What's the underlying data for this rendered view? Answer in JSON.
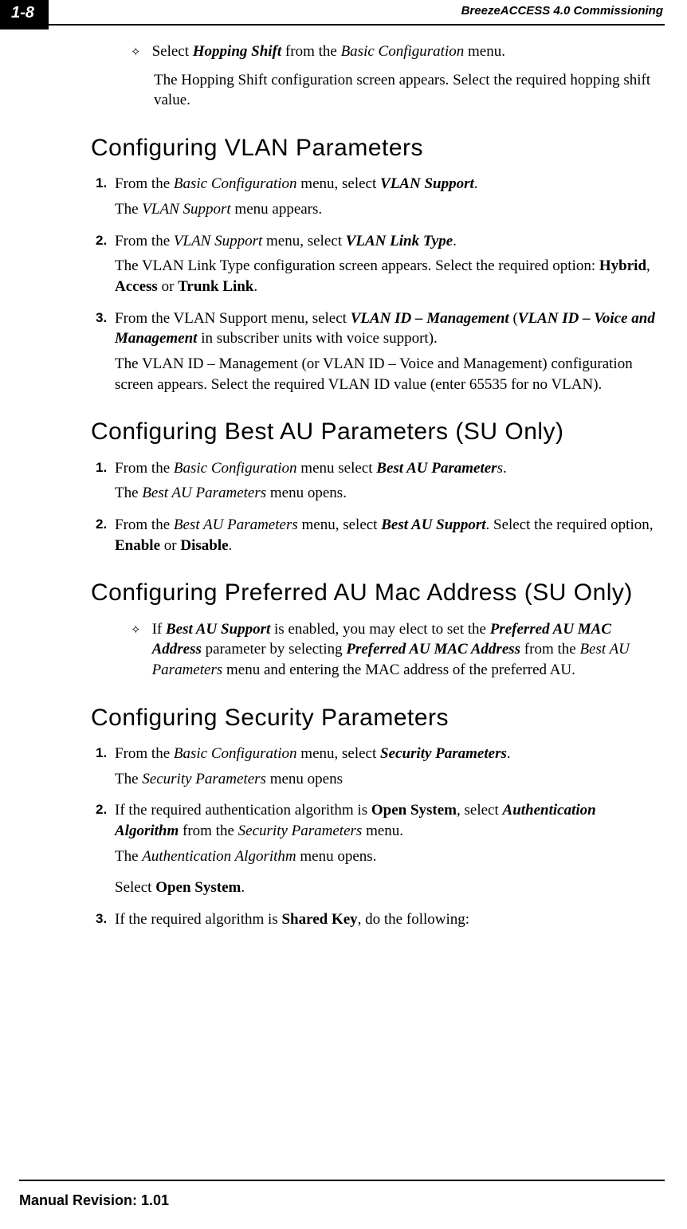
{
  "header": {
    "page_number": "1-8",
    "doc_title": "BreezeACCESS 4.0 Commissioning"
  },
  "intro": {
    "bullet_prefix": "Select ",
    "bullet_bold": "Hopping Shift",
    "bullet_mid": " from the ",
    "bullet_italic": "Basic Configuration",
    "bullet_suffix": " menu.",
    "follow": "The Hopping Shift configuration screen appears. Select the required hopping shift value."
  },
  "sections": {
    "vlan": {
      "title": "Configuring VLAN Parameters",
      "items": [
        {
          "num": "1.",
          "parts": [
            {
              "t": "From the "
            },
            {
              "t": "Basic Configuration",
              "i": true
            },
            {
              "t": " menu, select "
            },
            {
              "t": "VLAN Support",
              "bi": true
            },
            {
              "t": "."
            }
          ],
          "sub": [
            {
              "parts": [
                {
                  "t": "The "
                },
                {
                  "t": "VLAN Support",
                  "i": true
                },
                {
                  "t": " menu appears."
                }
              ]
            }
          ]
        },
        {
          "num": "2.",
          "parts": [
            {
              "t": "From the "
            },
            {
              "t": "VLAN Support",
              "i": true
            },
            {
              "t": " menu, select "
            },
            {
              "t": "VLAN Link Type",
              "bi": true
            },
            {
              "t": "."
            }
          ],
          "sub": [
            {
              "parts": [
                {
                  "t": "The VLAN Link Type configuration screen appears. Select the required option: "
                },
                {
                  "t": "Hybrid",
                  "b": true
                },
                {
                  "t": ", "
                },
                {
                  "t": "Access",
                  "b": true
                },
                {
                  "t": " or "
                },
                {
                  "t": "Trunk Link",
                  "b": true
                },
                {
                  "t": "."
                }
              ]
            }
          ]
        },
        {
          "num": "3.",
          "parts": [
            {
              "t": "From the VLAN Support menu, select "
            },
            {
              "t": "VLAN ID – Management",
              "bi": true
            },
            {
              "t": " ("
            },
            {
              "t": "VLAN ID – Voice and Management",
              "bi": true
            },
            {
              "t": " in subscriber units with voice support)."
            }
          ],
          "sub": [
            {
              "parts": [
                {
                  "t": "The VLAN ID – Management (or VLAN ID – Voice and Management) configuration screen appears. Select the required VLAN ID value (enter 65535 for no VLAN)."
                }
              ]
            }
          ]
        }
      ]
    },
    "bestau": {
      "title": "Configuring Best AU Parameters (SU Only)",
      "items": [
        {
          "num": "1.",
          "parts": [
            {
              "t": "From the "
            },
            {
              "t": "Basic Configuration",
              "i": true
            },
            {
              "t": " menu select "
            },
            {
              "t": "Best AU Parameter",
              "bi": true
            },
            {
              "t": "s",
              "i": true
            },
            {
              "t": "."
            }
          ],
          "sub": [
            {
              "parts": [
                {
                  "t": "The "
                },
                {
                  "t": "Best AU Parameters",
                  "i": true
                },
                {
                  "t": " menu opens."
                }
              ]
            }
          ]
        },
        {
          "num": "2.",
          "parts": [
            {
              "t": "From the "
            },
            {
              "t": "Best AU Parameters",
              "i": true
            },
            {
              "t": " menu, select "
            },
            {
              "t": "Best AU Support",
              "bi": true
            },
            {
              "t": ". Select the required option, "
            },
            {
              "t": "Enable",
              "b": true
            },
            {
              "t": " or "
            },
            {
              "t": "Disable",
              "b": true
            },
            {
              "t": "."
            }
          ],
          "sub": []
        }
      ]
    },
    "mac": {
      "title": "Configuring Preferred AU Mac Address (SU Only)",
      "bullet_parts": [
        {
          "t": "If "
        },
        {
          "t": "Best AU Support",
          "bi": true
        },
        {
          "t": " is enabled, you may elect to set the "
        },
        {
          "t": "Preferred AU MAC Address",
          "bi": true
        },
        {
          "t": " parameter by selecting "
        },
        {
          "t": "Preferred AU MAC Address",
          "bi": true
        },
        {
          "t": " from the "
        },
        {
          "t": "Best AU Parameters",
          "i": true
        },
        {
          "t": " menu and entering the MAC address of the preferred AU."
        }
      ]
    },
    "security": {
      "title": "Configuring Security Parameters",
      "items": [
        {
          "num": "1.",
          "parts": [
            {
              "t": "From the "
            },
            {
              "t": "Basic Configuration",
              "i": true
            },
            {
              "t": " menu, select "
            },
            {
              "t": "Security Parameters",
              "bi": true
            },
            {
              "t": "."
            }
          ],
          "sub": [
            {
              "parts": [
                {
                  "t": "The "
                },
                {
                  "t": "Security Parameters",
                  "i": true
                },
                {
                  "t": " menu opens"
                }
              ]
            }
          ]
        },
        {
          "num": "2.",
          "parts": [
            {
              "t": "If the required authentication algorithm is "
            },
            {
              "t": "Open System",
              "b": true
            },
            {
              "t": ", select "
            },
            {
              "t": "Authentication Algorithm",
              "bi": true
            },
            {
              "t": " from the "
            },
            {
              "t": "Security Parameters",
              "i": true
            },
            {
              "t": " menu."
            }
          ],
          "sub": [
            {
              "parts": [
                {
                  "t": "The "
                },
                {
                  "t": "Authentication Algorithm",
                  "i": true
                },
                {
                  "t": " menu opens."
                }
              ]
            },
            {
              "parts": [
                {
                  "t": "Select "
                },
                {
                  "t": "Open System",
                  "b": true
                },
                {
                  "t": "."
                }
              ]
            }
          ]
        },
        {
          "num": "3.",
          "parts": [
            {
              "t": "If the required algorithm is "
            },
            {
              "t": "Shared Key",
              "b": true
            },
            {
              "t": ", do the following:"
            }
          ],
          "sub": []
        }
      ]
    }
  },
  "footer": {
    "text": "Manual Revision: 1.01"
  }
}
